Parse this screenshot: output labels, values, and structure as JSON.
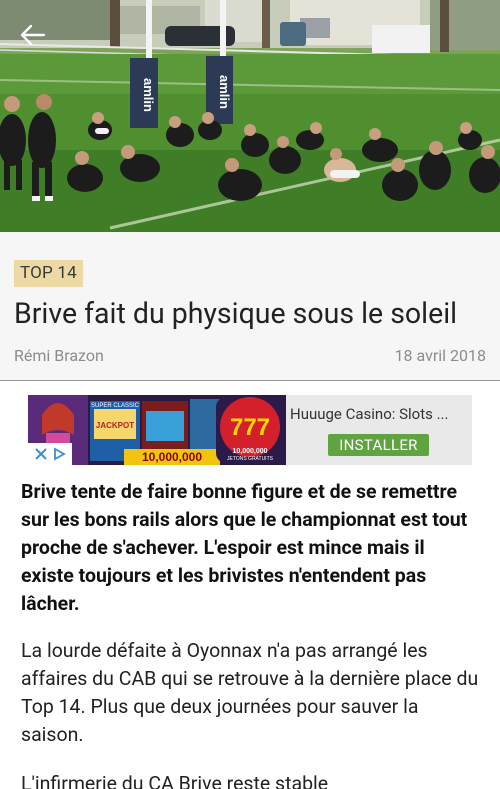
{
  "header": {
    "back_icon": "arrow-left-icon"
  },
  "hero": {
    "banner_text_left": "amlin",
    "banner_text_right": "amlin"
  },
  "article": {
    "category": "TOP 14",
    "title": "Brive fait du physique sous le soleil",
    "author": "Rémi Brazon",
    "date": "18 avril 2018",
    "lead": "Brive tente de faire bonne figure et de se remettre sur les bons rails alors que le championnat est tout proche de s'achever. L'espoir est mince mais il existe toujours et les brivistes n'entendent pas lâcher.",
    "paragraph_1": "La lourde défaite à Oyonnax n'a pas arrangé les affaires du CAB qui se retrouve à la dernière place du Top 14. Plus que deux journées pour sauver la saison.",
    "paragraph_2": "L'infirmerie du CA Brive reste stable"
  },
  "ad": {
    "title": "Huuuge Casino: Slots ...",
    "install_label": "INSTALLER",
    "image_text_1": "SUPER CLASSIC",
    "image_text_2": "JACKPOT",
    "image_text_3": "10,000,000",
    "image_text_4": "JETONS GRATUITS",
    "image_number": "777",
    "choices_icons": [
      "close-icon",
      "adchoices-icon"
    ],
    "colors": {
      "install_bg": "#5fa441"
    }
  },
  "colors": {
    "tag_bg": "#ecd9a4",
    "header_bg": "#f6f6f6"
  }
}
